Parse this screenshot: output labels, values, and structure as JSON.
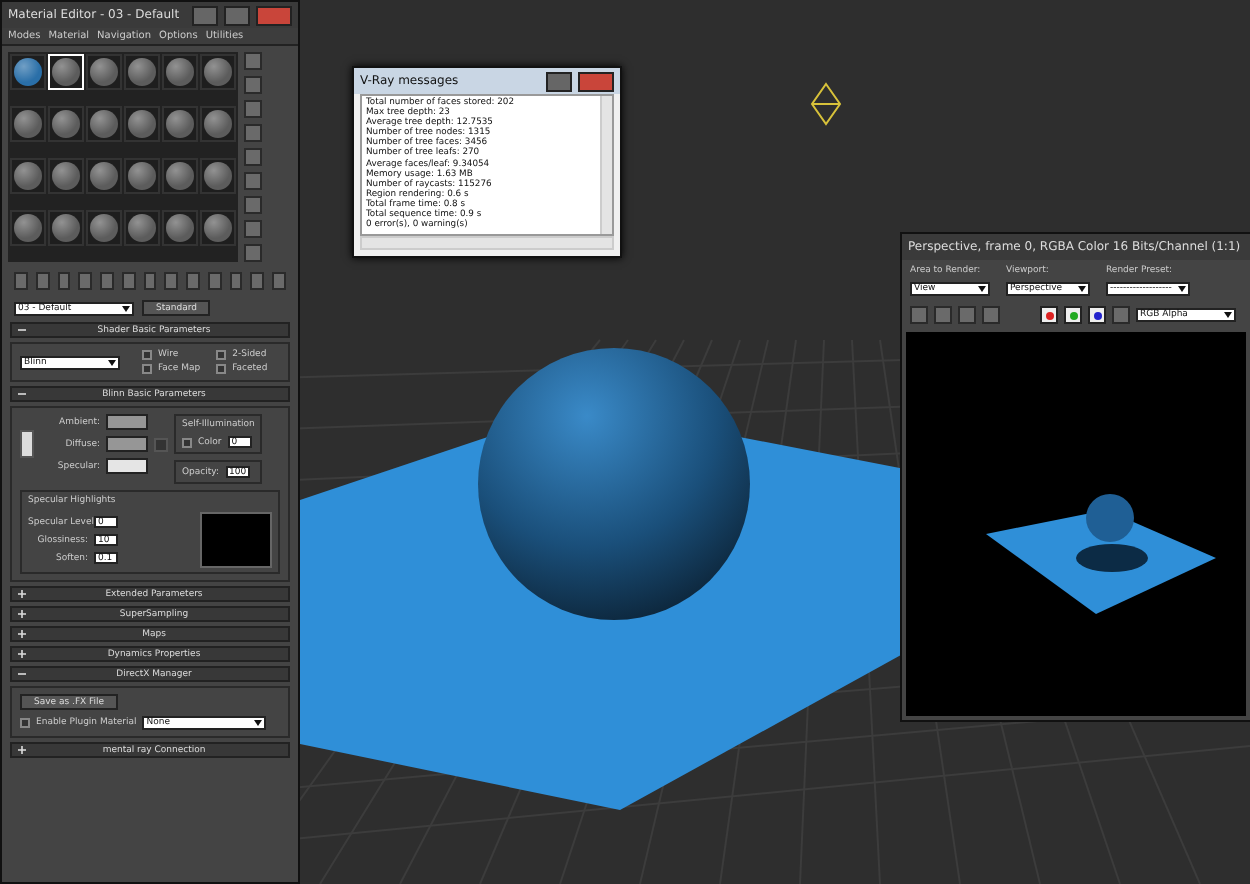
{
  "material_editor": {
    "title": "Material Editor - 03 - Default",
    "menu": [
      "Modes",
      "Material",
      "Navigation",
      "Options",
      "Utilities"
    ],
    "slots": [
      {
        "selected": false,
        "color": "#2a6fa8"
      },
      {
        "selected": true,
        "color": "#5c5c5c"
      },
      {
        "selected": false,
        "color": "#5c5c5c"
      },
      {
        "selected": false,
        "color": "#5c5c5c"
      },
      {
        "selected": false,
        "color": "#5c5c5c"
      },
      {
        "selected": false,
        "color": "#5c5c5c"
      },
      {
        "selected": false,
        "color": "#5c5c5c"
      },
      {
        "selected": false,
        "color": "#5c5c5c"
      },
      {
        "selected": false,
        "color": "#5c5c5c"
      },
      {
        "selected": false,
        "color": "#5c5c5c"
      },
      {
        "selected": false,
        "color": "#5c5c5c"
      },
      {
        "selected": false,
        "color": "#5c5c5c"
      },
      {
        "selected": false,
        "color": "#5c5c5c"
      },
      {
        "selected": false,
        "color": "#5c5c5c"
      },
      {
        "selected": false,
        "color": "#5c5c5c"
      },
      {
        "selected": false,
        "color": "#5c5c5c"
      },
      {
        "selected": false,
        "color": "#5c5c5c"
      },
      {
        "selected": false,
        "color": "#5c5c5c"
      },
      {
        "selected": false,
        "color": "#5c5c5c"
      },
      {
        "selected": false,
        "color": "#5c5c5c"
      },
      {
        "selected": false,
        "color": "#5c5c5c"
      },
      {
        "selected": false,
        "color": "#5c5c5c"
      },
      {
        "selected": false,
        "color": "#5c5c5c"
      },
      {
        "selected": false,
        "color": "#5c5c5c"
      }
    ],
    "material_name": "03 - Default",
    "material_type": "Standard",
    "shader": {
      "title": "Shader Basic Parameters",
      "expanded": true,
      "value": "Blinn",
      "options": [
        {
          "label": "Wire",
          "checked": false
        },
        {
          "label": "2-Sided",
          "checked": false
        },
        {
          "label": "Face Map",
          "checked": false
        },
        {
          "label": "Faceted",
          "checked": false
        }
      ]
    },
    "blinn": {
      "title": "Blinn Basic Parameters",
      "expanded": true,
      "colors": [
        {
          "label": "Ambient:",
          "color": "#969696"
        },
        {
          "label": "Diffuse:",
          "color": "#969696"
        },
        {
          "label": "Specular:",
          "color": "#e5e5e5"
        }
      ],
      "self_illumination": {
        "title": "Self-Illumination",
        "label": "Color",
        "checked": false,
        "value": "0"
      },
      "opacity": {
        "label": "Opacity:",
        "value": "100"
      },
      "highlights": {
        "title": "Specular Highlights",
        "fields": [
          {
            "label": "Specular Level:",
            "value": "0"
          },
          {
            "label": "Glossiness:",
            "value": "10"
          },
          {
            "label": "Soften:",
            "value": "0.1"
          }
        ]
      }
    },
    "rollouts": [
      {
        "title": "Extended Parameters",
        "expanded": false
      },
      {
        "title": "SuperSampling",
        "expanded": false
      },
      {
        "title": "Maps",
        "expanded": false
      },
      {
        "title": "Dynamics Properties",
        "expanded": false
      },
      {
        "title": "DirectX Manager",
        "expanded": true
      },
      {
        "title": "mental ray Connection",
        "expanded": false
      }
    ],
    "directx": {
      "button": "Save as .FX File",
      "plugin_label": "Enable Plugin Material",
      "plugin_checked": false,
      "plugin_value": "None"
    }
  },
  "vray": {
    "title": "V-Ray messages",
    "lines": [
      "Total number of faces stored: 202",
      "Max tree depth: 23",
      "Average tree depth: 12.7535",
      "Number of tree nodes: 1315",
      "Number of tree faces: 3456",
      "Number of tree leafs: 270",
      "Average faces/leaf: 9.34054",
      "Memory usage: 1.63 MB",
      "Number of raycasts: 115276",
      "Region rendering: 0.6 s",
      "Total frame time: 0.8 s",
      "Total sequence time: 0.9 s",
      "0 error(s), 0 warning(s)"
    ]
  },
  "render": {
    "title": "Perspective, frame 0, RGBA Color 16 Bits/Channel (1:1)",
    "area": {
      "label": "Area to Render:",
      "value": "View"
    },
    "viewport": {
      "label": "Viewport:",
      "value": "Perspective"
    },
    "preset": {
      "label": "Render Preset:",
      "value": "-------------------"
    },
    "channel": "RGB Alpha"
  }
}
